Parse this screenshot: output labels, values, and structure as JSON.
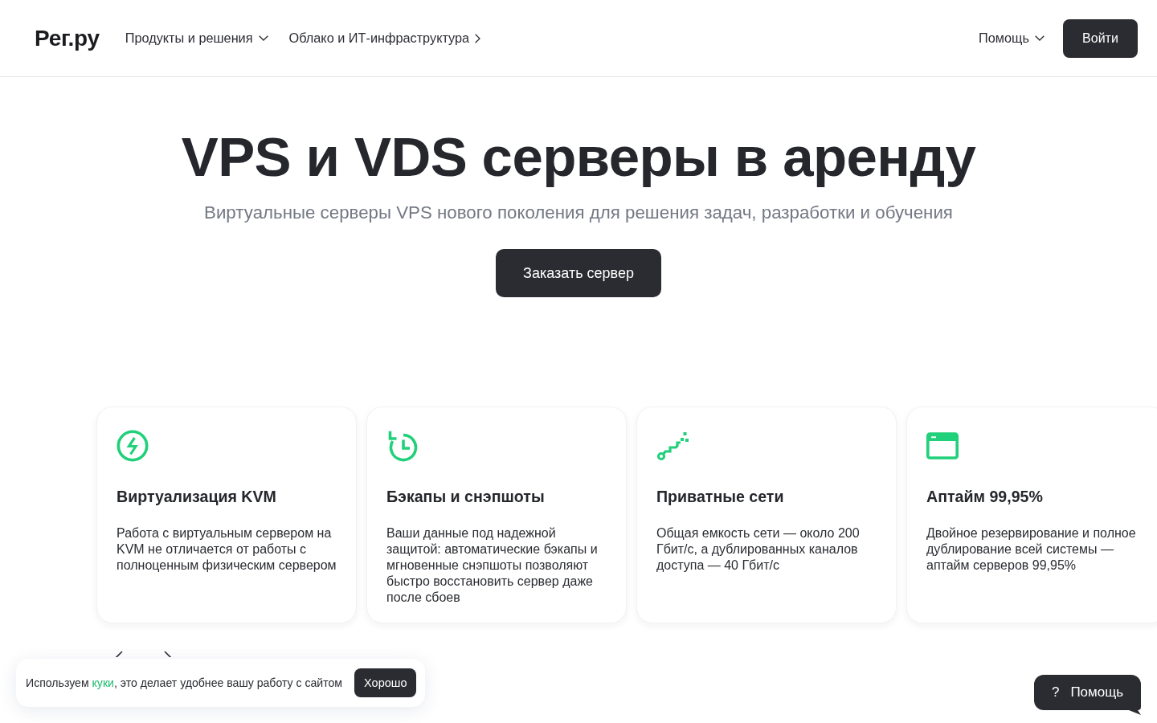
{
  "header": {
    "logo": "Рег.ру",
    "nav": [
      {
        "label": "Продукты и решения",
        "kind": "dropdown"
      },
      {
        "label": "Облако и ИТ-инфраструктура",
        "kind": "link"
      }
    ],
    "help_menu": {
      "label": "Помощь",
      "kind": "dropdown"
    },
    "login_button": "Войти"
  },
  "hero": {
    "title": "VPS и VDS серверы в аренду",
    "subtitle": "Виртуальные серверы VPS нового поколения для решения задач, разработки и обучения",
    "cta_button": "Заказать сервер"
  },
  "features": [
    {
      "title": "Виртуализация KVM",
      "text": "Работа с виртуальным сервером на KVM не отличается от работы с полноценным физическим сервером"
    },
    {
      "title": "Бэкапы и снэпшоты",
      "text": "Ваши данные под надежной защитой: автоматические бэкапы и мгновенные снэпшоты позволяют быстро восстановить сервер даже после сбоев"
    },
    {
      "title": "Приватные сети",
      "text": "Общая емкость сети — около 200 Гбит/с, а дублированных каналов доступа — 40 Гбит/с"
    },
    {
      "title": "Аптайм 99,95%",
      "text": "Двойное резервирование и полное дублирование всей системы — аптайм серверов 99,95%"
    }
  ],
  "cookie_banner": {
    "text_before": "Используем ",
    "link": "куки",
    "text_after": ", это делает удобнее вашу работу с сайтом",
    "button": "Хорошо"
  },
  "help_widget": {
    "mark": "?",
    "label": "Помощь"
  }
}
